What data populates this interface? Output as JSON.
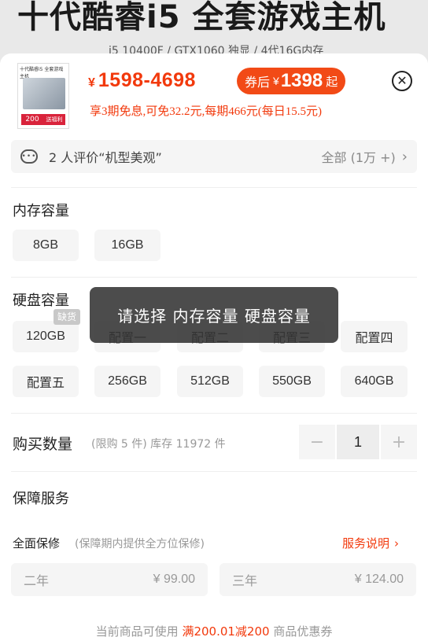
{
  "background": {
    "title": "十代酷睿i5 全套游戏主机",
    "subtitle": "i5 10400F / GTX1060 独显 / 4代16G内存"
  },
  "header": {
    "thumbnail_title": "十代酷睿i5 全套游戏主机",
    "thumbnail_badge": "200",
    "thumbnail_badge2": "送福利",
    "currency": "¥",
    "price_range": "1598-4698",
    "coupon_label": "券后",
    "coupon_currency": "¥",
    "coupon_price": "1398",
    "coupon_suffix": "起",
    "close_icon": "close-circle-icon",
    "installment_text": "享3期免息,可免32.2元,每期466元(每日15.5元)"
  },
  "review": {
    "icon": "chat-bubble-icon",
    "text": "2 人评价“机型美观”",
    "all_label": "全部 (1万 +)",
    "chevron": "›"
  },
  "memory": {
    "title": "内存容量",
    "options": [
      "8GB",
      "16GB"
    ]
  },
  "storage": {
    "title": "硬盘容量",
    "out_of_stock_tag": "缺货",
    "options_row1": [
      "120GB",
      "配置一",
      "配置二",
      "配置三",
      "配置四"
    ],
    "options_row2": [
      "配置五",
      "256GB",
      "512GB",
      "550GB",
      "640GB"
    ]
  },
  "quantity": {
    "label": "购买数量",
    "note": "(限购 5 件) 库存 11972 件",
    "minus": "−",
    "value": "1",
    "plus": "+"
  },
  "warranty": {
    "title": "保障服务",
    "full_label": "全面保修",
    "full_note": "(保障期内提供全方位保修)",
    "service_link": "服务说明",
    "service_chevron": "›",
    "options": [
      {
        "term": "二年",
        "price": "¥ 99.00"
      },
      {
        "term": "三年",
        "price": "¥ 124.00"
      }
    ]
  },
  "footer": {
    "prefix": "当前商品可使用",
    "highlight": "满200.01减200",
    "suffix": "商品优惠券"
  },
  "toast": {
    "text": "请选择 内存容量 硬盘容量"
  },
  "colors": {
    "accent": "#f2390c",
    "pill": "#f24a16",
    "option_bg": "#f5f5f5"
  }
}
